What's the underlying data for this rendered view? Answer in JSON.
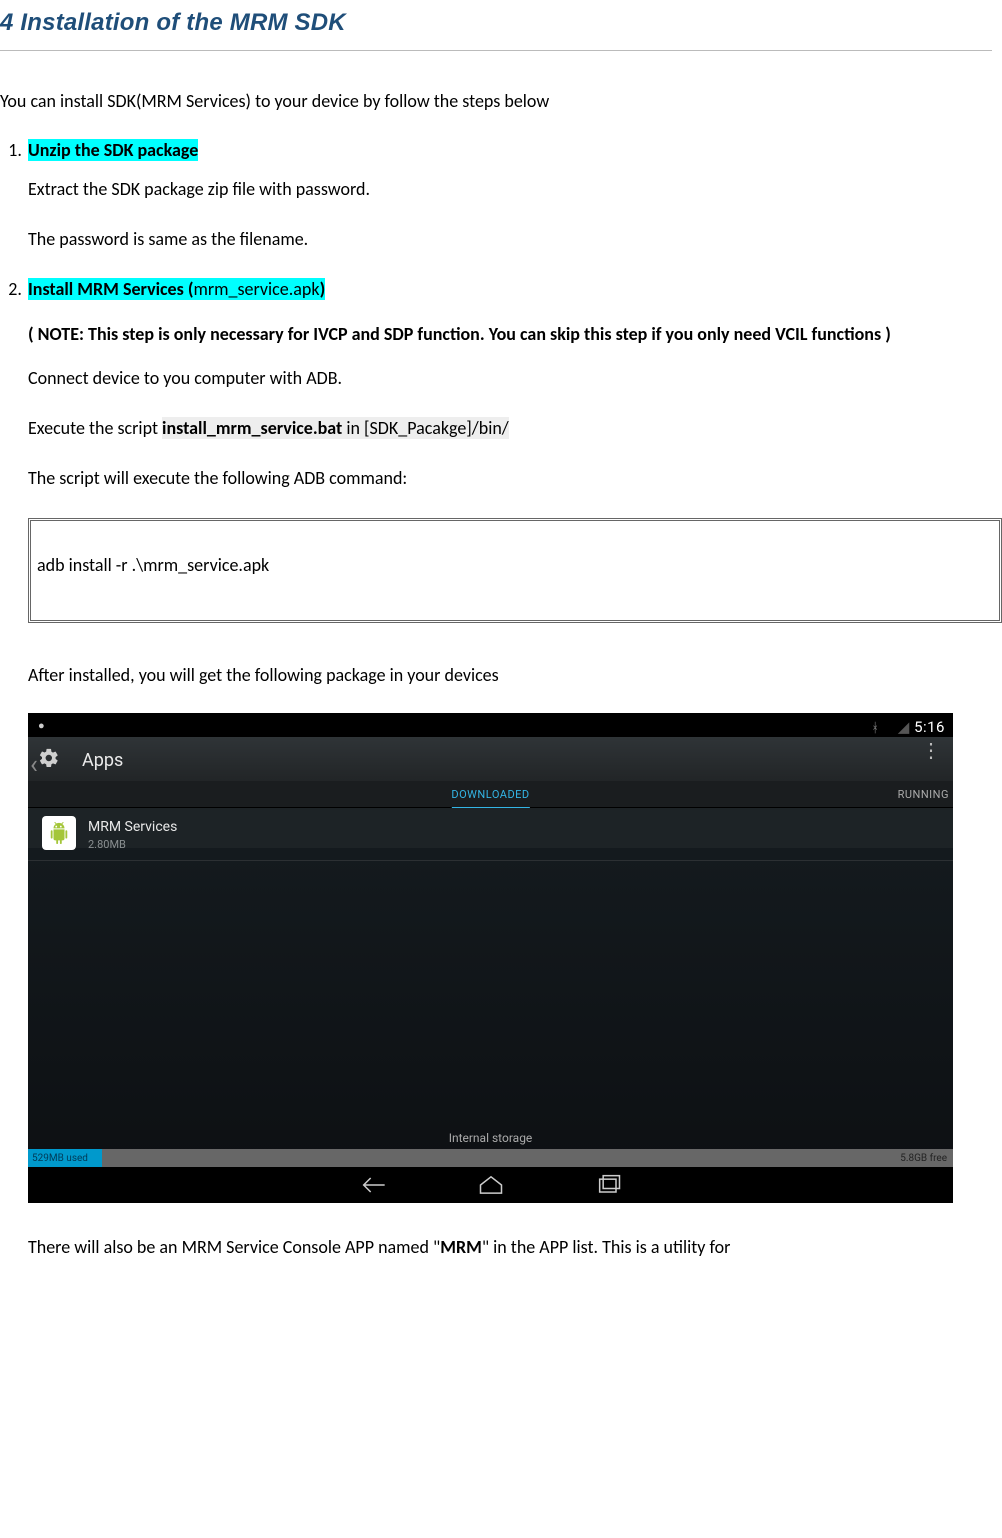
{
  "page": {
    "title": "4 Installation of the MRM SDK",
    "intro": "You can install SDK(MRM Services) to your device by follow the steps below"
  },
  "step1": {
    "heading": "Unzip the SDK package",
    "line1": "Extract the SDK package zip file with password.",
    "line2": "The password is same as the filename."
  },
  "step2": {
    "heading_pre": "Install MRM Services (",
    "heading_file": "mrm_service.apk",
    "heading_post": ")",
    "note": "( NOTE: This step is only necessary for IVCP and SDP function. You can skip this step if you only need VCIL functions )",
    "connect": "Connect device to you computer with ADB.",
    "exec_pre": "Execute the script ",
    "exec_script": "install_mrm_service.bat",
    "exec_in": " in ",
    "exec_path": "[SDK_Pacakge]/bin/",
    "adb_intro": "The script will execute the following ADB command:",
    "adb_cmd": "adb install -r .\\mrm_service.apk",
    "after_install": "After installed, you will get the following package in your devices"
  },
  "screenshot": {
    "time": "5:16",
    "apps_label": "Apps",
    "tab_downloaded": "DOWNLOADED",
    "tab_running": "RUNNING",
    "app_name": "MRM Services",
    "app_size": "2.80MB",
    "storage_label": "Internal storage",
    "storage_used": "529MB used",
    "storage_free": "5.8GB free"
  },
  "final": {
    "text_pre": "There will also be an MRM Service Console APP named \"",
    "text_bold": "MRM",
    "text_post": "\" in the APP list. This is a utility for"
  }
}
